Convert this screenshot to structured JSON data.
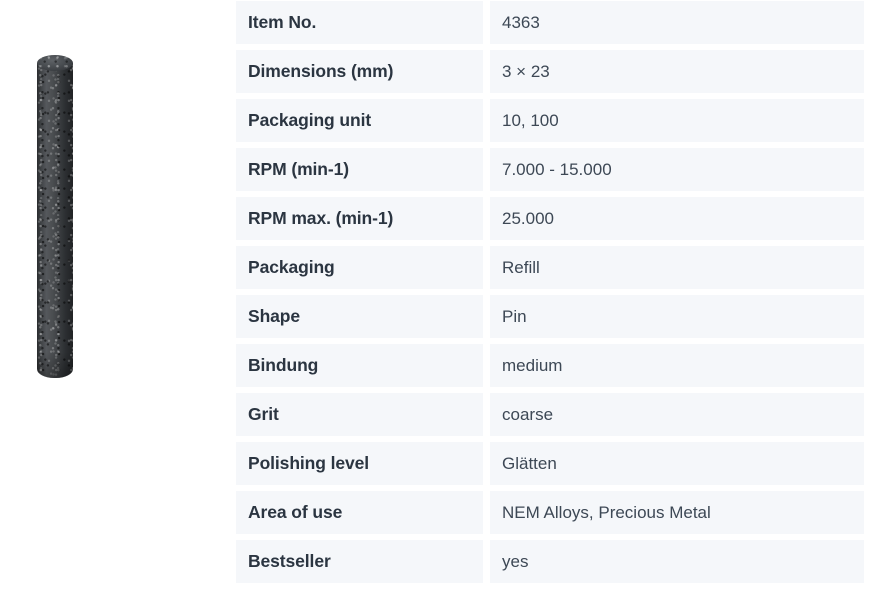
{
  "product_image": {
    "alt": "dental polishing pin, dark grey speckled cylinder",
    "icon": "polishing-pin-image"
  },
  "spec_table": {
    "rows": [
      {
        "label": "Item No.",
        "value": "4363"
      },
      {
        "label": "Dimensions (mm)",
        "value": "3 × 23"
      },
      {
        "label": "Packaging unit",
        "value": "10, 100"
      },
      {
        "label": "RPM (min-1)",
        "value": "7.000 - 15.000"
      },
      {
        "label": "RPM max. (min-1)",
        "value": "25.000"
      },
      {
        "label": "Packaging",
        "value": "Refill"
      },
      {
        "label": "Shape",
        "value": "Pin"
      },
      {
        "label": "Bindung",
        "value": "medium"
      },
      {
        "label": "Grit",
        "value": "coarse"
      },
      {
        "label": "Polishing level",
        "value": "Glätten"
      },
      {
        "label": "Area of use",
        "value": "NEM Alloys, Precious Metal"
      },
      {
        "label": "Bestseller",
        "value": "yes"
      }
    ]
  },
  "colors": {
    "row_background": "#f5f7fa",
    "page_background": "#ffffff",
    "label_text": "#2b3541",
    "value_text": "#3d4855"
  }
}
